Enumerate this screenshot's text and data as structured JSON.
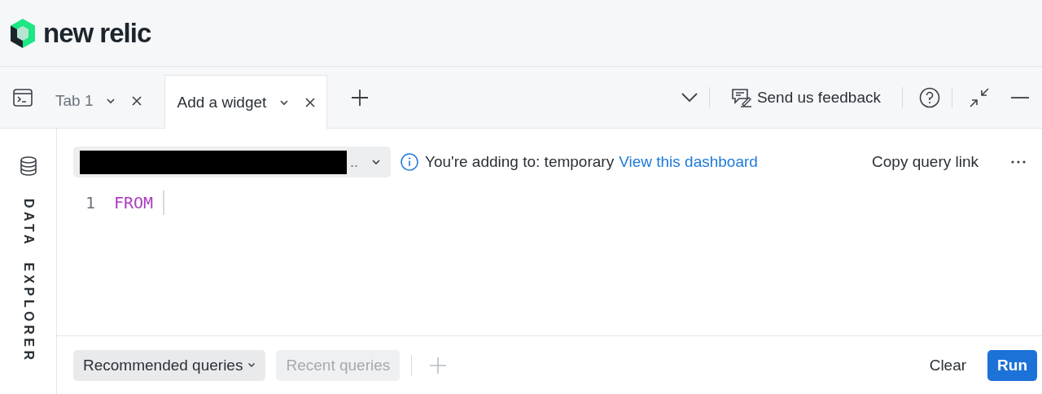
{
  "brand": {
    "name": "new relic"
  },
  "tabs": [
    {
      "label": "Tab 1",
      "selected": false
    },
    {
      "label": "Add a widget",
      "selected": true
    }
  ],
  "toolbar": {
    "feedback": "Send us feedback"
  },
  "sidebar": {
    "label": "DATA EXPLORER"
  },
  "account_selector": {
    "value": "..",
    "redacted": true
  },
  "notice": {
    "text": "You're adding to: temporary",
    "link": "View this dashboard"
  },
  "copy_link": "Copy query link",
  "editor": {
    "lines": [
      {
        "number": "1",
        "code": "FROM"
      }
    ]
  },
  "query_buttons": [
    {
      "label": "Recommended queries",
      "disabled": false,
      "dropdown": true
    },
    {
      "label": "Recent queries",
      "disabled": true,
      "dropdown": false
    }
  ],
  "actions": [
    {
      "label": "Clear",
      "kind": "plain"
    },
    {
      "label": "Run",
      "kind": "primary"
    }
  ]
}
